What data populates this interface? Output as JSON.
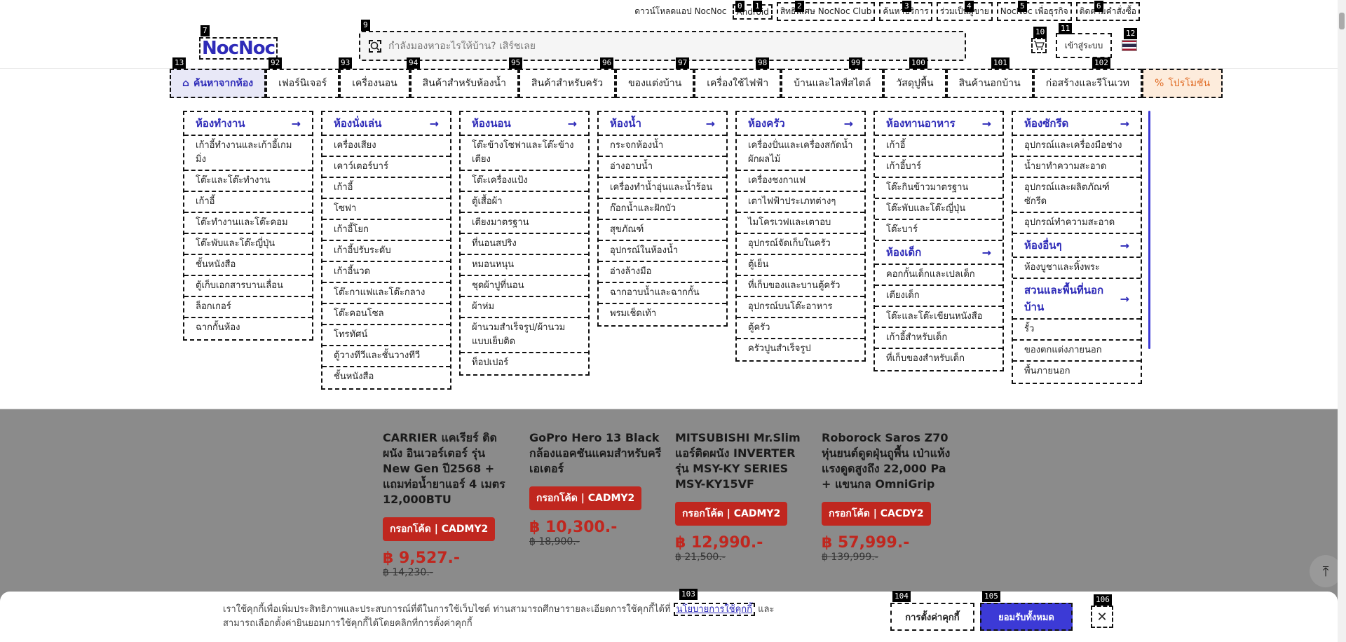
{
  "topbar": {
    "items": [
      "ดาวน์โหลดแอป NocNoc",
      "Android",
      "สิทธิพิเศษ NocNoc Club",
      "ค้นหาบริการ",
      "ร่วมเป็นผู้ขาย",
      "NocNoc เพื่อธุรกิจ",
      "ติดตามคำสั่งซื้อ"
    ]
  },
  "header": {
    "logo": "NocNoc",
    "search_placeholder": "กำลังมองหาอะไรให้บ้าน? เสิร์ชเลย",
    "login_label": "เข้าสู่ระบบ"
  },
  "catnav": [
    {
      "label": "ค้นหาจากห้อง",
      "icon": "home-icon"
    },
    {
      "label": "เฟอร์นิเจอร์"
    },
    {
      "label": "เครื่องนอน"
    },
    {
      "label": "สินค้าสำหรับห้องน้ำ"
    },
    {
      "label": "สินค้าสำหรับครัว"
    },
    {
      "label": "ของแต่งบ้าน"
    },
    {
      "label": "เครื่องใช้ไฟฟ้า"
    },
    {
      "label": "บ้านและไลฟ์สไตล์"
    },
    {
      "label": "วัสดุปูพื้น"
    },
    {
      "label": "สินค้านอกบ้าน"
    },
    {
      "label": "ก่อสร้างและรีโนเวท"
    },
    {
      "label": "โปรโมชัน",
      "icon": "percent-icon"
    }
  ],
  "megamenu": {
    "columns": [
      {
        "title": "ห้องทำงาน",
        "items": [
          "เก้าอี้ทำงานและเก้าอี้เกมมิ่ง",
          "โต๊ะและโต๊ะทำงาน",
          "เก้าอี้",
          "โต๊ะทำงานและโต๊ะคอม",
          "โต๊ะพับและโต๊ะญี่ปุ่น",
          "ชั้นหนังสือ",
          "ตู้เก็บเอกสารบานเลื่อน",
          "ล็อกเกอร์",
          "ฉากกั้นห้อง"
        ]
      },
      {
        "title": "ห้องนั่งเล่น",
        "items": [
          "เครื่องเสียง",
          "เคาว์เตอร์บาร์",
          "เก้าอี้",
          "โซฟา",
          "เก้าอี้โยก",
          "เก้าอี้ปรับระดับ",
          "เก้าอี้นวด",
          "โต๊ะกาแฟและโต๊ะกลาง",
          "โต๊ะคอนโซล",
          "โทรทัศน์",
          "ตู้วางทีวีและชั้นวางทีวี",
          "ชั้นหนังสือ"
        ]
      },
      {
        "title": "ห้องนอน",
        "items": [
          "โต๊ะข้างโซฟาและโต๊ะข้างเตียง",
          "โต๊ะเครื่องแป้ง",
          "ตู้เสื้อผ้า",
          "เตียงมาตรฐาน",
          "ที่นอนสปริง",
          "หมอนหนุน",
          "ชุดผ้าปูที่นอน",
          "ผ้าห่ม",
          "ผ้านวมสำเร็จรูป/ผ้านวมแบบเย็บติด",
          "ท็อปเปอร์"
        ]
      },
      {
        "title": "ห้องน้ำ",
        "items": [
          "กระจกห้องน้ำ",
          "อ่างอาบน้ำ",
          "เครื่องทำน้ำอุ่นและน้ำร้อน",
          "ก๊อกน้ำและฝักบัว",
          "สุขภัณฑ์",
          "อุปกรณ์ในห้องน้ำ",
          "อ่างล้างมือ",
          "ฉากอาบน้ำและฉากกั้น",
          "พรมเช็ดเท้า"
        ]
      },
      {
        "title": "ห้องครัว",
        "items": [
          "เครื่องปั่นและเครื่องสกัดน้ำผักผลไม้",
          "เครื่องชงกาแฟ",
          "เตาไฟฟ้าประเภทต่างๆ",
          "ไมโครเวฟและเตาอบ",
          "อุปกรณ์จัดเก็บในครัว",
          "ตู้เย็น",
          "ที่เก็บของและบานตู้ครัว",
          "อุปกรณ์บนโต๊ะอาหาร",
          "ตู้ครัว",
          "ครัวปูนสำเร็จรูป"
        ]
      },
      {
        "title": "ห้องทานอาหาร",
        "items": [
          "เก้าอี้",
          "เก้าอี้บาร์",
          "โต๊ะกินข้าวมาตรฐาน",
          "โต๊ะพับและโต๊ะญี่ปุ่น",
          "โต๊ะบาร์"
        ],
        "title2": "ห้องเด็ก",
        "items2": [
          "คอกกั้นเด็กและเปลเด็ก",
          "เตียงเด็ก",
          "โต๊ะและโต๊ะเขียนหนังสือ",
          "เก้าอี้สำหรับเด็ก",
          "ที่เก็บของสำหรับเด็ก"
        ]
      },
      {
        "title": "ห้องซักรีด",
        "items": [
          "อุปกรณ์และเครื่องมือช่าง",
          "น้ำยาทำความสะอาด",
          "อุปกรณ์และผลิตภัณฑ์ซักรีด",
          "อุปกรณ์ทำความสะอาด"
        ],
        "title2": "ห้องอื่นๆ",
        "items2": [
          "ห้องบูชาและหิ้งพระ"
        ],
        "title3": "สวนและพื้นที่นอกบ้าน",
        "items3": [
          "รั้ว",
          "ของตกแต่งภายนอก",
          "พื้นภายนอก"
        ]
      }
    ]
  },
  "products": [
    {
      "title": "CARRIER แคเรียร์ ติดผนัง อินเวอร์เตอร์ รุ่น New Gen ปี2568 + แถมท่อน้ำยาแอร์ 4 เมตร 12,000BTU",
      "code": "กรอกโค้ด | CADMY2",
      "price": "฿ 9,527.-",
      "old": "฿ 14,230.-"
    },
    {
      "title": "GoPro Hero 13 Black กล้องแอคชันแคมสำหรับครีเอเตอร์",
      "code": "กรอกโค้ด | CADMY2",
      "price": "฿ 10,300.-",
      "old": "฿ 18,900.-"
    },
    {
      "title": "MITSUBISHI Mr.Slim แอร์ติดผนัง INVERTER รุ่น MSY-KY SERIES MSY-KY15VF",
      "code": "กรอกโค้ด | CADMY2",
      "price": "฿ 12,990.-",
      "old": "฿ 21,500.-"
    },
    {
      "title": "Roborock Saros Z70 หุ่นยนต์ดูดฝุ่นถูพื้น เป่าแห้งแรงดูดสูงถึง 22,000 Pa + แขนกล OmniGrip",
      "code": "กรอกโค้ด | CACDY2",
      "price": "฿ 57,999.-",
      "old": "฿ 139,999.-"
    }
  ],
  "cookie": {
    "text_before": "เราใช้คุกกี้เพื่อเพิ่มประสิทธิภาพและประสบการณ์ที่ดีในการใช้เว็บไซต์ ท่านสามารถศึกษารายละเอียดการใช้คุกกี้ได้ที่ ",
    "link": "นโยบายการใช้คุกกี้",
    "text_after": " และสามารถเลือกตั้งค่ายินยอมการใช้คุกกี้ได้โดยคลิกที่การตั้งค่าคุกกี้",
    "settings_label": "การตั้งค่าคุกกี้",
    "accept_label": "ยอมรับทั้งหมด",
    "close_label": "✕"
  },
  "colors": {
    "brand": "#2e2bb8",
    "accent": "#3c3ad6",
    "promo": "#e06b24",
    "sale": "#c0271f"
  },
  "tags": [
    "0",
    "1",
    "2",
    "3",
    "4",
    "5",
    "6",
    "7",
    "9",
    "10",
    "11",
    "12",
    "13",
    "92",
    "93",
    "94",
    "95",
    "96",
    "97",
    "98",
    "99",
    "100",
    "101",
    "102",
    "103",
    "104",
    "105",
    "106"
  ]
}
